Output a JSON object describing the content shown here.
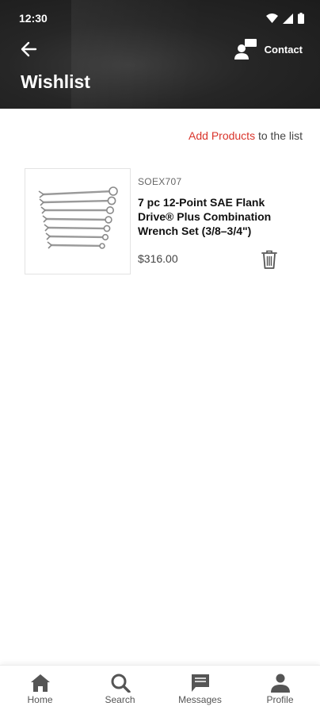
{
  "status_bar": {
    "time": "12:30",
    "icons": [
      "wifi-icon",
      "signal-icon",
      "battery-icon"
    ]
  },
  "header": {
    "back_icon": "arrow-left-icon",
    "contact_icon": "contact-person-icon",
    "contact_label": "Contact",
    "title": "Wishlist"
  },
  "add_products": {
    "link_text": "Add Products",
    "suffix_text": " to the list"
  },
  "wishlist_items": [
    {
      "sku": "SOEX707",
      "name": "7 pc 12-Point SAE Flank Drive® Plus Combination Wrench Set (3/8–3/4\")",
      "price": "$316.00",
      "image_icon": "wrench-set-image",
      "delete_icon": "trash-icon"
    }
  ],
  "bottom_nav": [
    {
      "label": "Home",
      "icon": "home-icon"
    },
    {
      "label": "Search",
      "icon": "search-icon"
    },
    {
      "label": "Messages",
      "icon": "messages-icon"
    },
    {
      "label": "Profile",
      "icon": "profile-icon"
    }
  ],
  "colors": {
    "header_bg": "#262626",
    "accent_red": "#d9342b",
    "nav_icon": "#555555"
  }
}
